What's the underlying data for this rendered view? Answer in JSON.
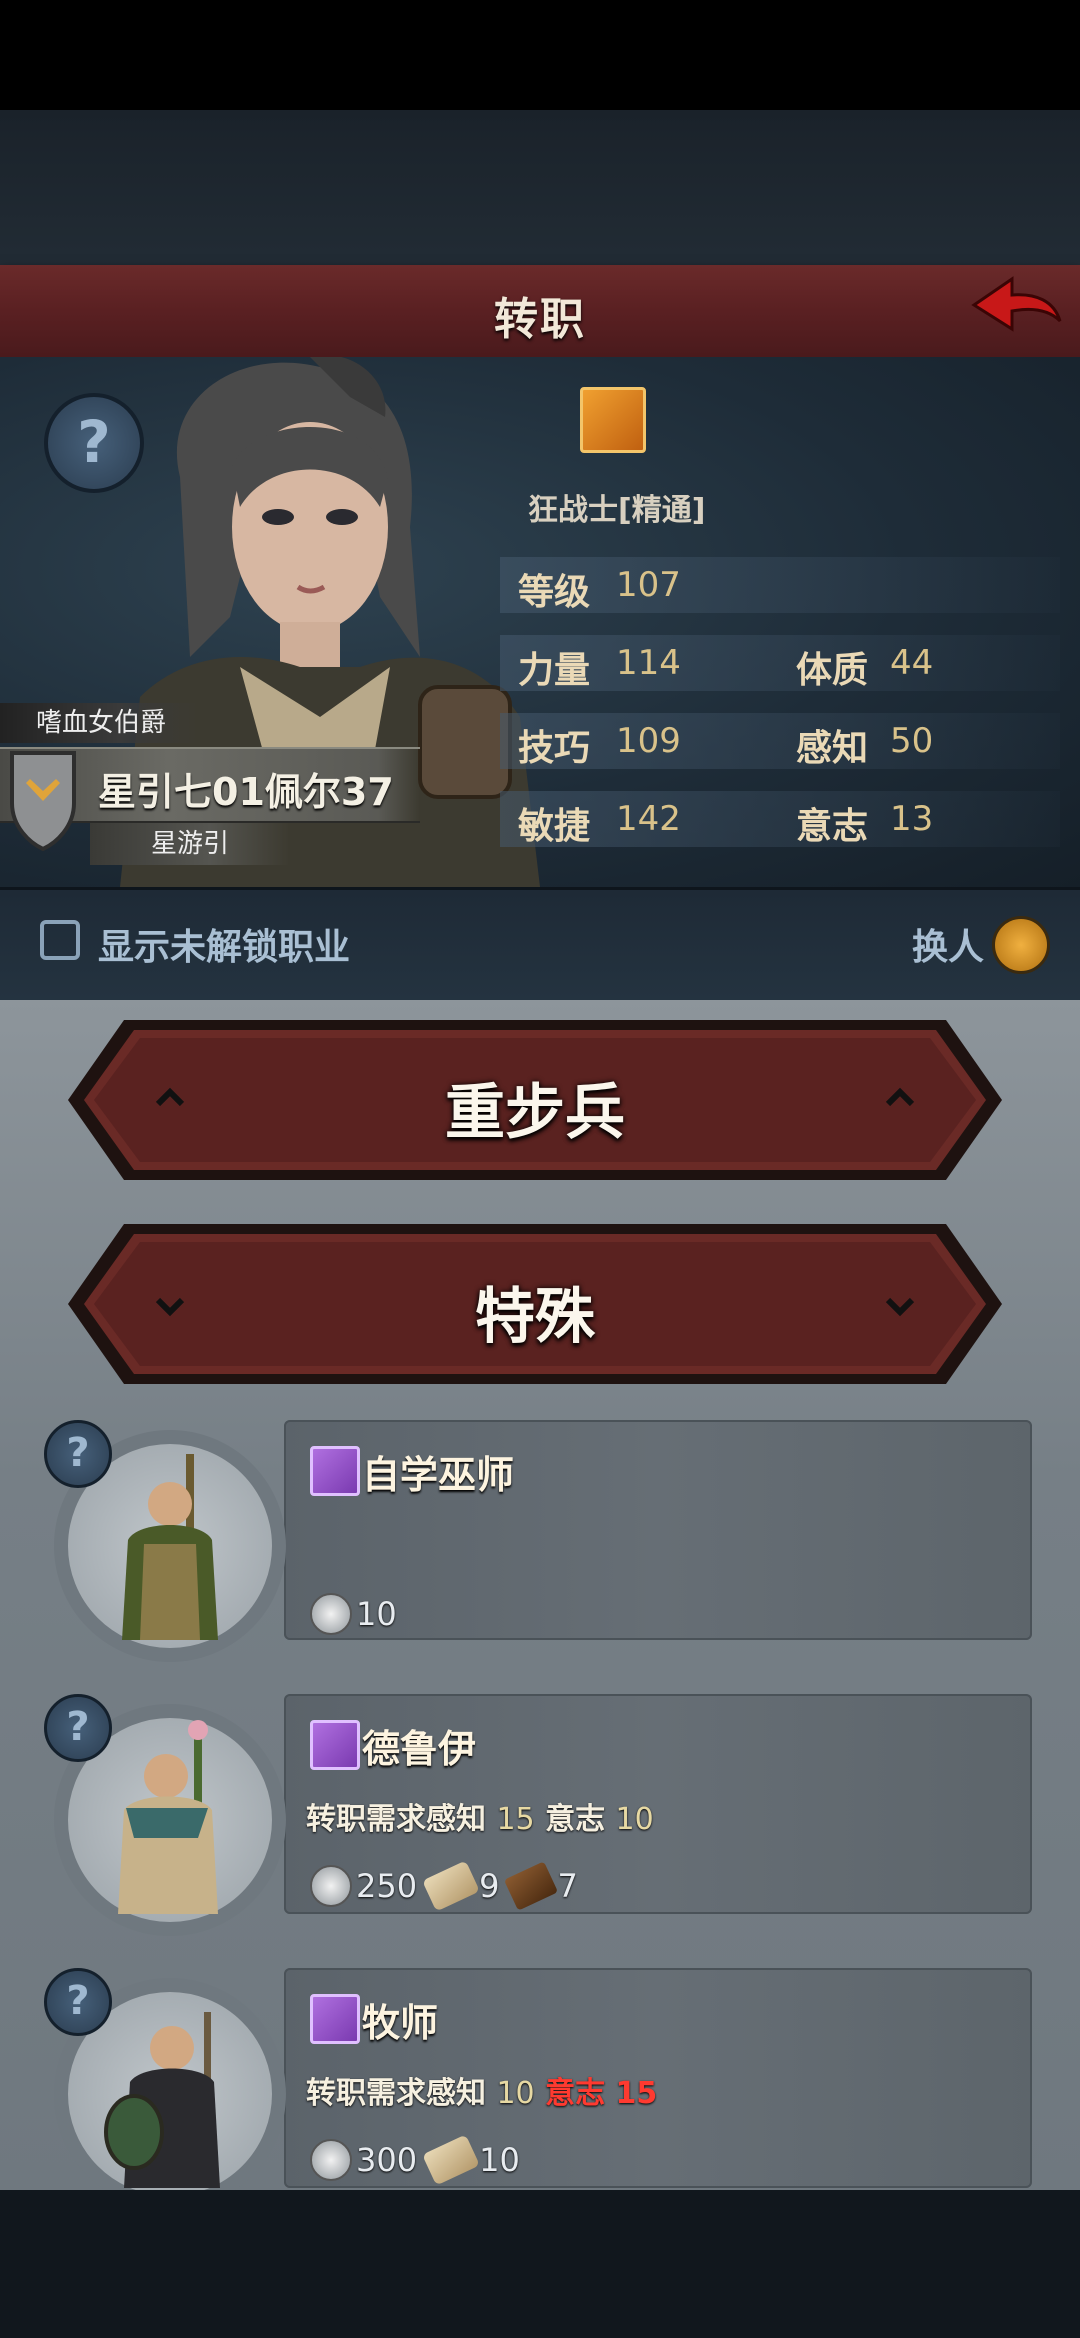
{
  "header": {
    "title": "转职"
  },
  "character": {
    "class_name": "狂战士[精通]",
    "title": "嗜血女伯爵",
    "name": "星引七01佩尔37",
    "guild": "星游引",
    "stats": {
      "level": {
        "label": "等级",
        "value": "107"
      },
      "strength": {
        "label": "力量",
        "value": "114"
      },
      "constitution": {
        "label": "体质",
        "value": "44"
      },
      "skill": {
        "label": "技巧",
        "value": "109"
      },
      "perception": {
        "label": "感知",
        "value": "50"
      },
      "agility": {
        "label": "敏捷",
        "value": "142"
      },
      "willpower": {
        "label": "意志",
        "value": "13"
      }
    }
  },
  "options": {
    "show_locked_label": "显示未解锁职业",
    "show_locked_checked": false,
    "switch_label": "换人"
  },
  "categories": [
    {
      "label": "重步兵",
      "state": "collapsed"
    },
    {
      "label": "特殊",
      "state": "expanded"
    }
  ],
  "jobs": [
    {
      "name": "自学巫师",
      "requirement": null,
      "cost": {
        "silver": "10"
      }
    },
    {
      "name": "德鲁伊",
      "requirement": {
        "prefix": "转职需求",
        "a_label": "感知",
        "a_value": "15",
        "b_label": "意志",
        "b_value": "10"
      },
      "cost": {
        "silver": "250",
        "scroll": "9",
        "wood": "7"
      }
    },
    {
      "name": "牧师",
      "requirement": {
        "prefix": "转职需求",
        "a_label": "感知",
        "a_value": "10",
        "b_label": "意志",
        "b_value": "15"
      },
      "cost": {
        "silver": "300",
        "scroll": "10"
      }
    }
  ],
  "colors": {
    "header_red": "#5a2022",
    "stat_gold": "#d9c28a",
    "unmet": "#ff3a30"
  }
}
